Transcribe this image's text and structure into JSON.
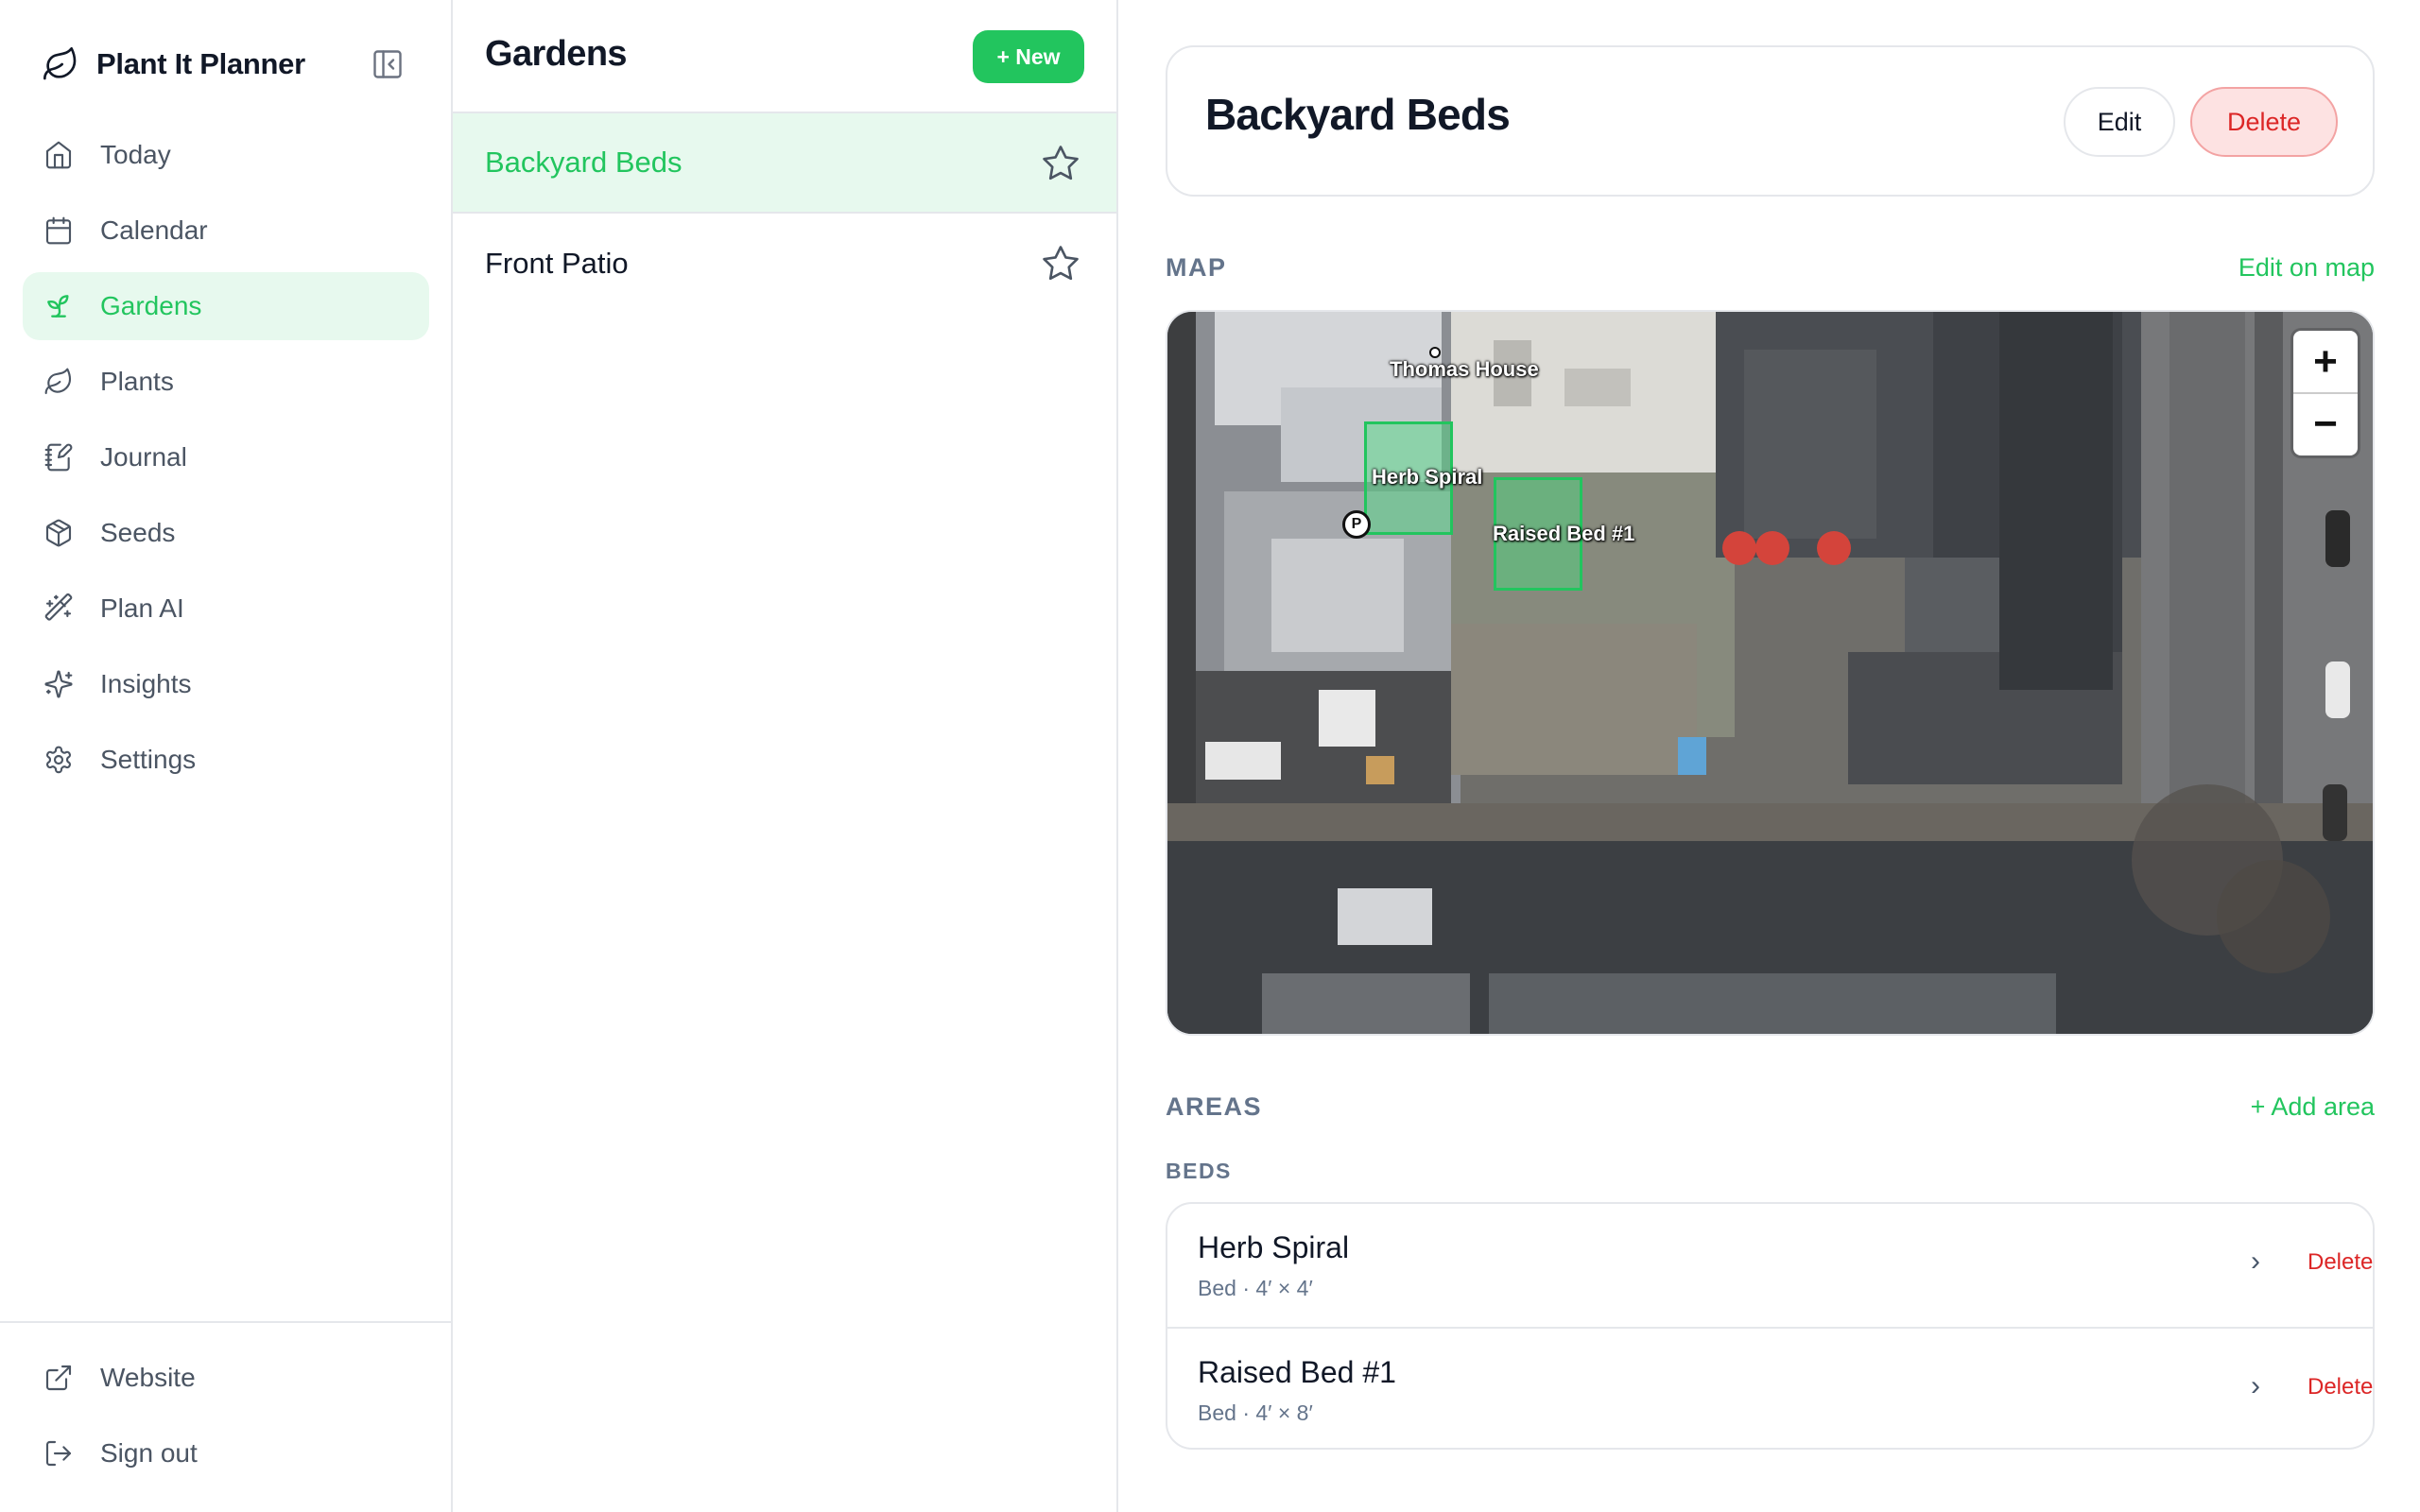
{
  "app": {
    "name": "Plant It Planner"
  },
  "sidebar": {
    "items": [
      {
        "label": "Today",
        "icon": "home-icon"
      },
      {
        "label": "Calendar",
        "icon": "calendar-icon"
      },
      {
        "label": "Gardens",
        "icon": "sprout-icon",
        "active": true
      },
      {
        "label": "Plants",
        "icon": "leaf-icon"
      },
      {
        "label": "Journal",
        "icon": "notebook-pen-icon"
      },
      {
        "label": "Seeds",
        "icon": "package-icon"
      },
      {
        "label": "Plan AI",
        "icon": "wand-icon"
      },
      {
        "label": "Insights",
        "icon": "sparkles-icon"
      },
      {
        "label": "Settings",
        "icon": "gear-icon"
      }
    ],
    "footer": [
      {
        "label": "Website",
        "icon": "external-link-icon"
      },
      {
        "label": "Sign out",
        "icon": "log-out-icon"
      }
    ]
  },
  "gardens_list": {
    "title": "Gardens",
    "new_label": "+ New",
    "items": [
      {
        "name": "Backyard Beds",
        "selected": true
      },
      {
        "name": "Front Patio",
        "selected": false
      }
    ]
  },
  "detail": {
    "title": "Backyard Beds",
    "edit_label": "Edit",
    "delete_label": "Delete",
    "map_section": {
      "label": "MAP",
      "edit_link": "Edit on map",
      "zoom_in": "+",
      "zoom_out": "−",
      "labels": {
        "house": "Thomas House",
        "poi_parking": "P",
        "herb_spiral": "Herb Spiral",
        "raised_bed": "Raised Bed #1"
      }
    },
    "areas_section": {
      "label": "AREAS",
      "add_link": "+ Add area",
      "group_label": "BEDS",
      "beds": [
        {
          "name": "Herb Spiral",
          "meta": "Bed · 4′ × 4′",
          "delete_label": "Delete"
        },
        {
          "name": "Raised Bed #1",
          "meta": "Bed · 4′ × 8′",
          "delete_label": "Delete"
        }
      ]
    }
  },
  "colors": {
    "accent": "#22c55e",
    "accent_bg": "#e7f9ee",
    "danger": "#dc2626",
    "danger_bg": "#fde2e2",
    "muted": "#64748b",
    "border": "#e5e7eb"
  }
}
